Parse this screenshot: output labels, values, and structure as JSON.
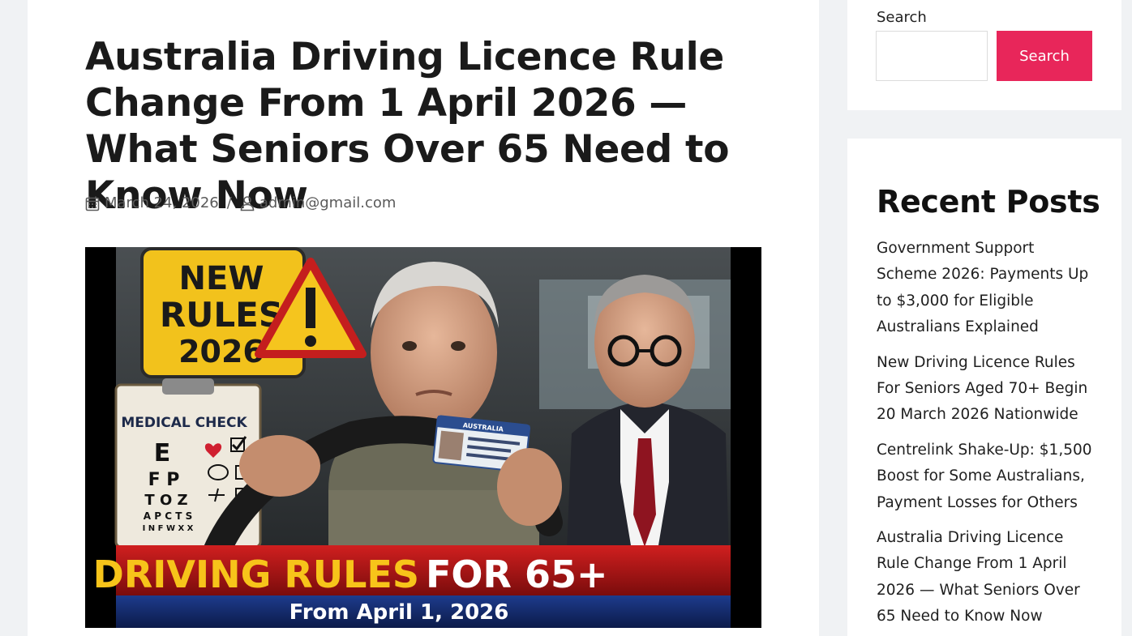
{
  "article": {
    "title": "Australia Driving Licence Rule Change From 1 April 2026 — What Seniors Over 65 Need to Know Now",
    "date": "March 24, 2026",
    "separator": "/",
    "author": "admin@gmail.com",
    "image": {
      "sign_text": [
        "NEW",
        "RULES",
        "2026"
      ],
      "clipboard_title": "MEDICAL CHECK",
      "chart_rows": [
        "E",
        "F P",
        "T O Z",
        "A P C T S",
        "I N F W X X"
      ],
      "licence_header": "AUSTRALIA",
      "banner_text_yellow": "NEW DRIVING RULES",
      "banner_text_white": "FOR 65+",
      "banner_subtext": "From April 1, 2026"
    }
  },
  "sidebar": {
    "search": {
      "label": "Search",
      "placeholder": "",
      "value": "",
      "button_label": "Search",
      "button_color": "#e8265a"
    },
    "recent_posts": {
      "title": "Recent Posts",
      "items": [
        {
          "label": "Government Support Scheme 2026: Payments Up to $3,000 for Eligible Australians Explained"
        },
        {
          "label": "New Driving Licence Rules For Seniors Aged 70+ Begin 20 March 2026 Nationwide"
        },
        {
          "label": "Centrelink Shake-Up: $1,500 Boost for Some Australians, Payment Losses for Others"
        },
        {
          "label": "Australia Driving Licence Rule Change From 1 April 2026 — What Seniors Over 65 Need to Know Now"
        }
      ]
    }
  },
  "colors": {
    "page_bg": "#f0f2f4",
    "card_bg": "#ffffff",
    "accent": "#e8265a",
    "meta_text": "#5a5a5a"
  }
}
